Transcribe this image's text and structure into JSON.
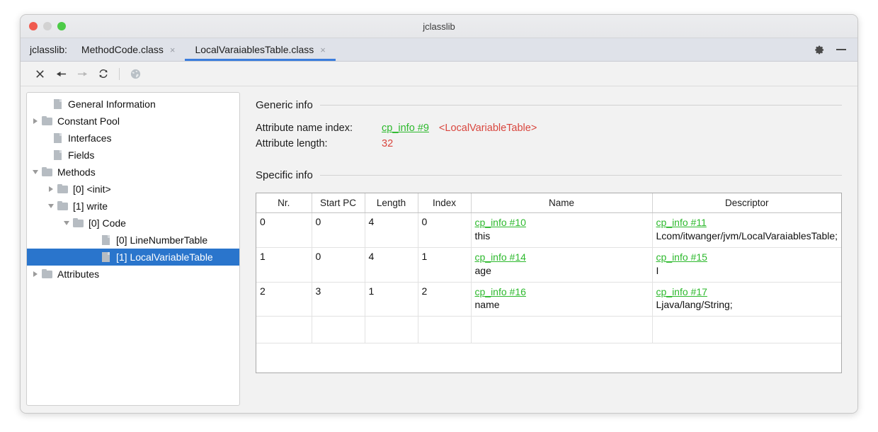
{
  "window": {
    "title": "jclasslib",
    "traffic_lights": [
      "close-red",
      "minimize-gray",
      "maximize-green"
    ]
  },
  "tabbar": {
    "prefix": "jclasslib:",
    "tabs": [
      {
        "label": "MethodCode.class",
        "close": "×",
        "active": false
      },
      {
        "label": "LocalVaraiablesTable.class",
        "close": "×",
        "active": true
      }
    ],
    "settings_icon": "gear-icon",
    "minimize_icon": "minus-icon"
  },
  "toolbar": {
    "buttons": [
      {
        "icon": "close-icon",
        "enabled": true
      },
      {
        "icon": "back-arrow-icon",
        "enabled": true
      },
      {
        "icon": "forward-arrow-icon",
        "enabled": false
      },
      {
        "icon": "reload-icon",
        "enabled": true
      },
      {
        "icon": "globe-icon",
        "enabled": true
      }
    ]
  },
  "sidebar": {
    "items": [
      {
        "label": "General Information",
        "indent": 1,
        "twisty": "none",
        "icon": "file"
      },
      {
        "label": "Constant Pool",
        "indent": 0,
        "twisty": "collapsed",
        "icon": "folder"
      },
      {
        "label": "Interfaces",
        "indent": 1,
        "twisty": "none",
        "icon": "file"
      },
      {
        "label": "Fields",
        "indent": 1,
        "twisty": "none",
        "icon": "file"
      },
      {
        "label": "Methods",
        "indent": 0,
        "twisty": "expanded",
        "icon": "folder"
      },
      {
        "label": "[0] <init>",
        "indent": 1,
        "twisty": "collapsed",
        "icon": "folder"
      },
      {
        "label": "[1] write",
        "indent": 1,
        "twisty": "expanded",
        "icon": "folder"
      },
      {
        "label": "[0] Code",
        "indent": 2,
        "twisty": "expanded",
        "icon": "folder"
      },
      {
        "label": "[0] LineNumberTable",
        "indent": 4,
        "twisty": "none",
        "icon": "file"
      },
      {
        "label": "[1] LocalVariableTable",
        "indent": 4,
        "twisty": "none",
        "icon": "file",
        "selected": true
      },
      {
        "label": "Attributes",
        "indent": 0,
        "twisty": "collapsed",
        "icon": "folder"
      }
    ],
    "selection_color": "#2a75cc"
  },
  "main": {
    "generic_info": {
      "heading": "Generic info",
      "rows": [
        {
          "key": "Attribute name index:",
          "link": "cp_info #9",
          "value": "<LocalVariableTable>",
          "value_color": "#d9463e"
        },
        {
          "key": "Attribute length:",
          "link": "",
          "value": "32",
          "value_color": "#d9463e"
        }
      ]
    },
    "specific_info": {
      "heading": "Specific info",
      "table": {
        "columns": [
          "Nr.",
          "Start PC",
          "Length",
          "Index",
          "Name",
          "Descriptor"
        ],
        "rows": [
          {
            "nr": "0",
            "start_pc": "0",
            "length": "4",
            "index": "0",
            "name_link": "cp_info #10",
            "name_value": "this",
            "descriptor_link": "cp_info #11",
            "descriptor_value": "Lcom/itwanger/jvm/LocalVaraiablesTable;"
          },
          {
            "nr": "1",
            "start_pc": "0",
            "length": "4",
            "index": "1",
            "name_link": "cp_info #14",
            "name_value": "age",
            "descriptor_link": "cp_info #15",
            "descriptor_value": "I"
          },
          {
            "nr": "2",
            "start_pc": "3",
            "length": "1",
            "index": "2",
            "name_link": "cp_info #16",
            "name_value": "name",
            "descriptor_link": "cp_info #17",
            "descriptor_value": "Ljava/lang/String;"
          }
        ]
      }
    },
    "link_color": "#2db92d"
  }
}
